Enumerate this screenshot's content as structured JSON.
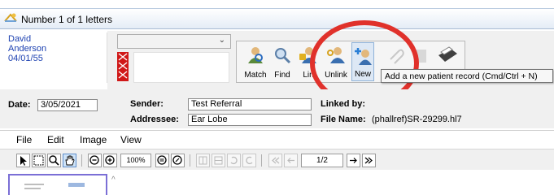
{
  "window": {
    "title": "Number 1 of 1 letters"
  },
  "patient": {
    "first_name": "David",
    "last_name": "Anderson",
    "dob": "04/01/55"
  },
  "actions": [
    {
      "id": "match",
      "label": "Match",
      "icon": "match-person-icon",
      "enabled": true
    },
    {
      "id": "find",
      "label": "Find",
      "icon": "magnifier-icon",
      "enabled": true
    },
    {
      "id": "link",
      "label": "Lin",
      "icon": "link-person-icon",
      "enabled": true
    },
    {
      "id": "unlink",
      "label": "Unlink",
      "icon": "unlink-person-icon",
      "enabled": true
    },
    {
      "id": "new",
      "label": "New",
      "icon": "new-patient-icon",
      "enabled": true
    }
  ],
  "tooltip": "Add a new patient record (Cmd/Ctrl + N)",
  "info": {
    "date_label": "Date:",
    "date_value": "3/05/2021",
    "sender_label": "Sender:",
    "sender_value": "Test Referral",
    "addressee_label": "Addressee:",
    "addressee_value": "Ear Lobe",
    "linked_by_label": "Linked by:",
    "file_name_label": "File Name:",
    "file_name_value": "(phallref)SR-29299.hl7"
  },
  "menu": [
    "File",
    "Edit",
    "Image",
    "View"
  ],
  "viewer": {
    "zoom": "100%",
    "page": "1/2"
  },
  "colors": {
    "highlight_circle": "#e0312b",
    "patient_text": "#1a3fb0",
    "flag": "#d01818",
    "thumb_border": "#7b6fd6"
  }
}
